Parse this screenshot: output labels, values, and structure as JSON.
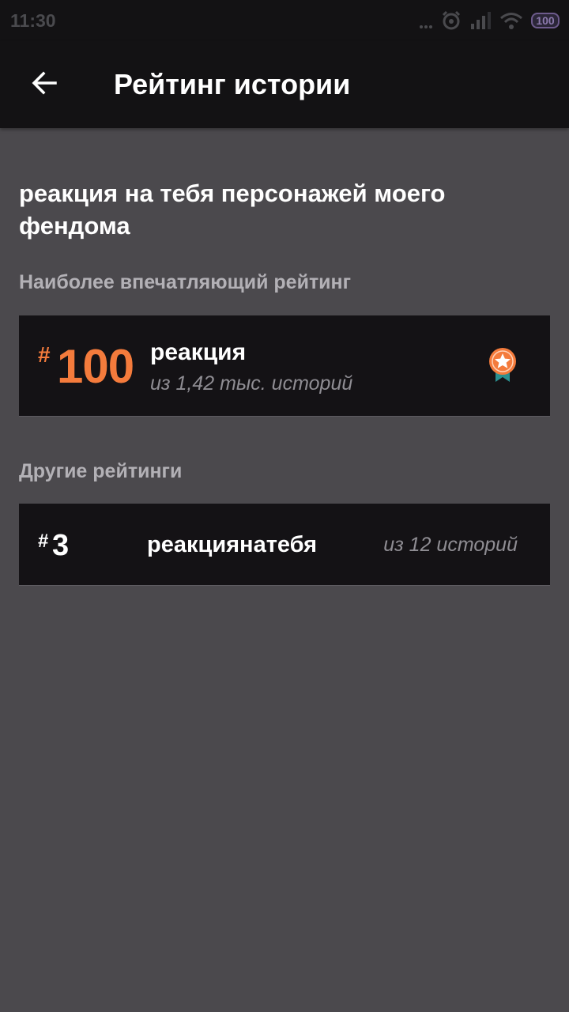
{
  "status_bar": {
    "time": "11:30",
    "battery": "100",
    "icons": [
      "more-dots-icon",
      "alarm-icon",
      "signal-icon",
      "wifi-icon",
      "battery-icon"
    ]
  },
  "app_bar": {
    "title": "Рейтинг истории",
    "back_icon": "arrow-left-icon"
  },
  "story": {
    "title": "реакция на тебя персонажей моего фендома"
  },
  "top_ranking": {
    "section_label": "Наиболее впечатляющий рейтинг",
    "hash": "#",
    "rank": "100",
    "tag": "реакция",
    "subtitle": "из 1,42 тыс. историй",
    "badge_icon": "medal-star-icon"
  },
  "other_rankings": {
    "section_label": "Другие рейтинги",
    "items": [
      {
        "hash": "#",
        "rank": "3",
        "tag": "реакциянатебя",
        "subtitle": "из 12 историй"
      }
    ]
  },
  "colors": {
    "background": "#4b494d",
    "bar": "#131214",
    "card": "#141215",
    "accent": "#f47b3c",
    "badge_ribbon": "#2a8f8f"
  }
}
